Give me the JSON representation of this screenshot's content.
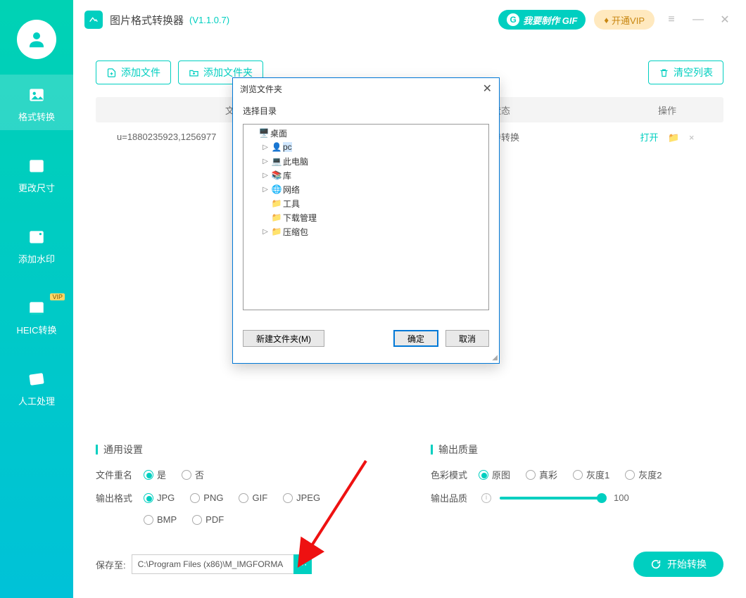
{
  "header": {
    "title": "图片格式转换器",
    "version": "(V1.1.0.7)",
    "gif_btn": "我要制作 GIF",
    "vip_btn": "开通VIP"
  },
  "sidebar": {
    "items": [
      {
        "label": "格式转换"
      },
      {
        "label": "更改尺寸"
      },
      {
        "label": "添加水印"
      },
      {
        "label": "HEIC转换",
        "vip": "VIP"
      },
      {
        "label": "人工处理"
      }
    ]
  },
  "toolbar": {
    "add_file": "添加文件",
    "add_folder": "添加文件夹",
    "clear_list": "清空列表"
  },
  "table": {
    "cols": {
      "name": "文件名称",
      "status": "状态",
      "action": "操作"
    },
    "rows": [
      {
        "name": "u=1880235923,1256977",
        "status": "等待转换",
        "open": "打开"
      }
    ]
  },
  "settings": {
    "general_title": "通用设置",
    "rename_label": "文件重名",
    "rename_options": [
      "是",
      "否"
    ],
    "format_label": "输出格式",
    "formats": [
      "JPG",
      "PNG",
      "GIF",
      "JPEG",
      "BMP",
      "PDF"
    ],
    "quality_title": "输出质量",
    "color_label": "色彩模式",
    "color_options": [
      "原图",
      "真彩",
      "灰度1",
      "灰度2"
    ],
    "quality_label": "输出品质",
    "quality_value": "100"
  },
  "bottom": {
    "save_label": "保存至:",
    "path": "C:\\Program Files (x86)\\M_IMGFORMA",
    "start": "开始转换"
  },
  "dialog": {
    "title": "浏览文件夹",
    "subtitle": "选择目录",
    "tree": [
      {
        "depth": 0,
        "arrow": "",
        "icon": "🖥️",
        "label": "桌面"
      },
      {
        "depth": 1,
        "arrow": "▷",
        "icon": "👤",
        "label": "pc",
        "selected": true
      },
      {
        "depth": 1,
        "arrow": "▷",
        "icon": "💻",
        "label": "此电脑"
      },
      {
        "depth": 1,
        "arrow": "▷",
        "icon": "📚",
        "label": "库"
      },
      {
        "depth": 1,
        "arrow": "▷",
        "icon": "🌐",
        "label": "网络"
      },
      {
        "depth": 1,
        "arrow": "",
        "icon": "📁",
        "label": "工具"
      },
      {
        "depth": 1,
        "arrow": "",
        "icon": "📁",
        "label": "下载管理"
      },
      {
        "depth": 1,
        "arrow": "▷",
        "icon": "📁",
        "label": "压缩包"
      }
    ],
    "new_folder": "新建文件夹(M)",
    "ok": "确定",
    "cancel": "取消"
  }
}
